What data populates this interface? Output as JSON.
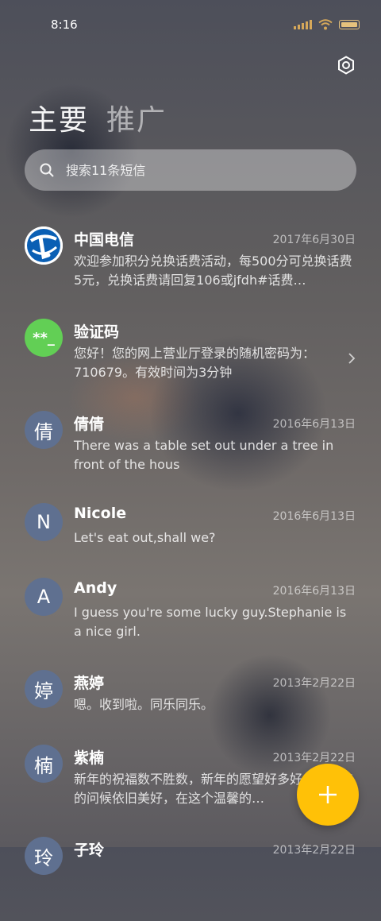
{
  "status_bar": {
    "time": "8:16"
  },
  "tabs": [
    {
      "label": "主要",
      "active": true
    },
    {
      "label": "推广",
      "active": false
    }
  ],
  "search": {
    "placeholder": "搜索11条短信"
  },
  "messages": [
    {
      "name": "中国电信",
      "date": "2017年6月30日",
      "preview": "欢迎参加积分兑换话费活动，每500分可兑换话费5元，兑换话费请回复106或jfdh#话费…",
      "avatar": "telecom-logo-icon"
    },
    {
      "name": "验证码",
      "preview": "您好！您的网上营业厅登录的随机密码为：710679。有效时间为3分钟",
      "avatar_text": "**_"
    },
    {
      "name": "倩倩",
      "date": "2016年6月13日",
      "preview": "There was a table set out under a tree in front of the hous",
      "avatar_text": "倩"
    },
    {
      "name": "Nicole",
      "date": "2016年6月13日",
      "preview": "Let's eat out,shall we?",
      "avatar_text": "N"
    },
    {
      "name": "Andy",
      "date": "2016年6月13日",
      "preview": "I guess you're some lucky guy.Stephanie is a nice girl.",
      "avatar_text": "A"
    },
    {
      "name": "燕婷",
      "date": "2013年2月22日",
      "preview": "嗯。收到啦。同乐同乐。",
      "avatar_text": "婷"
    },
    {
      "name": "紫楠",
      "date": "2013年2月22日",
      "preview": "新年的祝福数不胜数，新年的愿望好多好多，新年的问候依旧美好，在这个温馨的…",
      "avatar_text": "楠"
    },
    {
      "name": "子玲",
      "date": "2013年2月22日",
      "preview": "",
      "avatar_text": "玲"
    }
  ],
  "fab": {
    "icon": "plus-icon"
  },
  "colors": {
    "fab": "#ffc107",
    "avatar": "#5f7090",
    "verify_avatar": "#62cf55",
    "telecom": "#0a5fb4"
  }
}
